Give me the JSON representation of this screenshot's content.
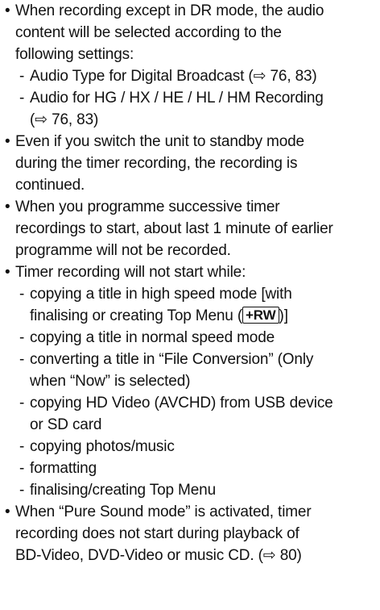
{
  "bullets": [
    {
      "lines": [
        "When recording except in DR mode, the audio",
        "content will be selected according to the",
        "following settings:"
      ],
      "subitems": [
        {
          "lines": [
            "Audio Type for Digital Broadcast (⇨ 76, 83)"
          ]
        },
        {
          "lines": [
            "Audio for HG / HX / HE / HL / HM Recording",
            "(⇨ 76, 83)"
          ]
        }
      ]
    },
    {
      "lines": [
        "Even if you switch the unit to standby mode",
        "during the timer recording, the recording is",
        "continued."
      ]
    },
    {
      "lines": [
        "When you programme successive timer",
        "recordings to start, about last 1 minute of earlier",
        "programme will not be recorded."
      ]
    },
    {
      "lines": [
        "Timer recording will not start while:"
      ],
      "subitems": [
        {
          "line1": "copying a title in high speed mode [with",
          "line2_pre": "finalising or creating Top Menu (",
          "badge": "+RW",
          "line2_post": ")]"
        },
        {
          "lines": [
            "copying a title in normal speed mode"
          ]
        },
        {
          "lines": [
            "converting a title in “File Conversion” (Only",
            "when “Now” is selected)"
          ]
        },
        {
          "lines": [
            "copying HD Video (AVCHD) from USB device",
            "or SD card"
          ]
        },
        {
          "lines": [
            "copying photos/music"
          ]
        },
        {
          "lines": [
            "formatting"
          ]
        },
        {
          "lines": [
            "finalising/creating Top Menu"
          ]
        }
      ]
    },
    {
      "lines": [
        "When “Pure Sound mode” is activated, timer",
        "recording does not start during playback of",
        "BD-Video, DVD-Video or music CD. (⇨ 80)"
      ]
    }
  ]
}
